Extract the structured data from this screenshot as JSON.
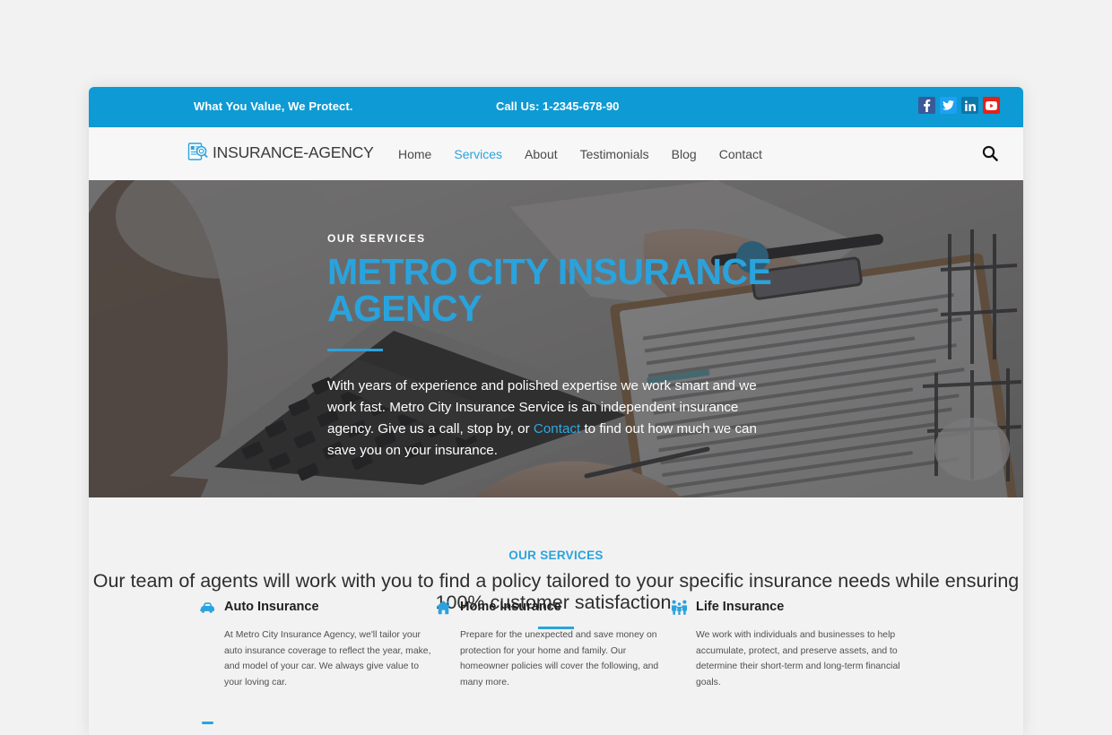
{
  "topbar": {
    "tagline": "What You Value, We Protect.",
    "call_label": "Call Us: 1-2345-678-90",
    "social": [
      {
        "name": "facebook",
        "label": "f"
      },
      {
        "name": "twitter",
        "label": "t"
      },
      {
        "name": "linkedin",
        "label": "in"
      },
      {
        "name": "youtube",
        "label": "yt"
      }
    ]
  },
  "navbar": {
    "brand": "INSURANCE-AGENCY",
    "links": [
      {
        "label": "Home",
        "active": false
      },
      {
        "label": "Services",
        "active": true
      },
      {
        "label": "About",
        "active": false
      },
      {
        "label": "Testimonials",
        "active": false
      },
      {
        "label": "Blog",
        "active": false
      },
      {
        "label": "Contact",
        "active": false
      }
    ],
    "search_label": "Search"
  },
  "hero": {
    "eyebrow": "OUR SERVICES",
    "title": "METRO CITY INSURANCE AGENCY",
    "paragraph_before": "With years of experience and polished expertise we work smart and we work fast. Metro City Insurance Service is an independent insurance agency. Give us a call, stop by, or ",
    "paragraph_link": "Contact",
    "paragraph_after": " to find out how much we can save you on your insurance."
  },
  "services": {
    "eyebrow": "OUR SERVICES",
    "title": "Our team of agents will work with you to find a policy tailored to your specific insurance needs while ensuring 100% customer satisfaction.",
    "cards": [
      {
        "icon": "car-icon",
        "title": "Auto Insurance",
        "body": "At Metro City Insurance Agency, we'll tailor your auto insurance coverage to reflect the year, make, and model of your car. We always give value to your loving car."
      },
      {
        "icon": "home-icon",
        "title": "Home Insurance",
        "body": "Prepare for the unexpected and save money on protection for your home and family. Our homeowner policies will cover the following, and many more."
      },
      {
        "icon": "family-icon",
        "title": "Life Insurance",
        "body": "We work with individuals and businesses to help accumulate, protect, and preserve assets, and to determine their short-term and long-term financial goals."
      }
    ]
  },
  "colors": {
    "brand_blue": "#0e9ad4",
    "accent_blue": "#2ba3de",
    "topbar_bg": "#0e9ad4",
    "nav_bg": "#f7f7f7",
    "services_bg": "#f2f2f2",
    "page_bg": "#f2f2f2"
  }
}
